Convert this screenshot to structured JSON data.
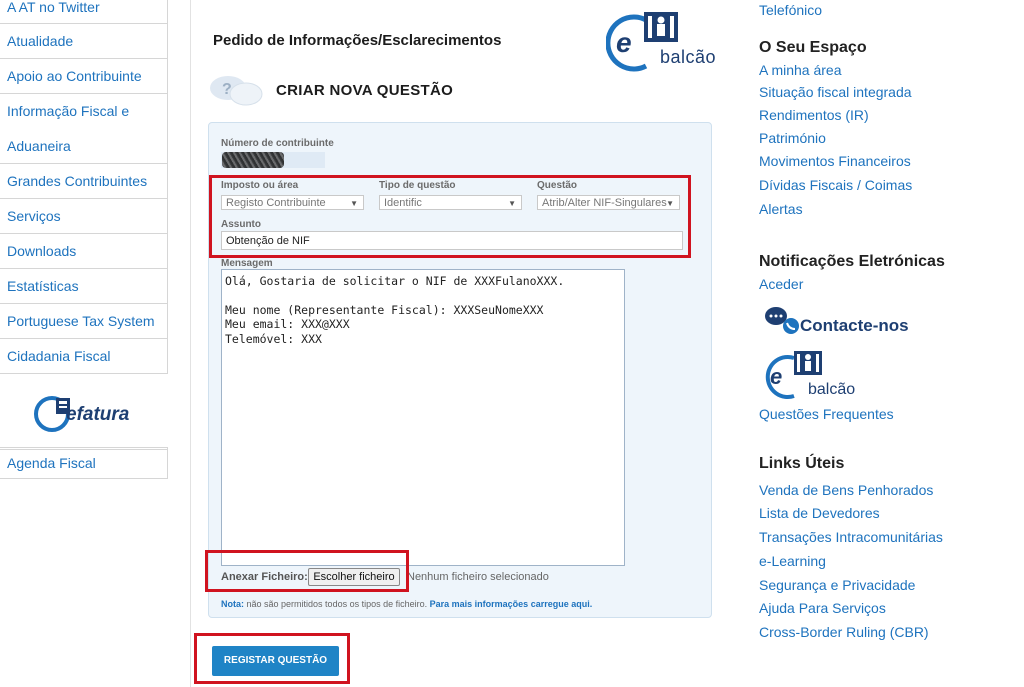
{
  "left_nav": {
    "items": [
      "A AT no Twitter",
      "Atualidade",
      "Apoio ao Contribuinte",
      "Informação Fiscal e",
      "Aduaneira",
      "Grandes Contribuintes",
      "Serviços",
      "Downloads",
      "Estatísticas",
      "Portuguese Tax System",
      "Cidadania Fiscal"
    ],
    "efatura_label": "efatura",
    "agenda": "Agenda Fiscal"
  },
  "main": {
    "page_title": "Pedido de Informações/Esclarecimentos",
    "balcao_label": "balcão",
    "new_question_title": "CRIAR NOVA QUESTÃO",
    "form": {
      "nif_label": "Número de contribuinte",
      "tax_area_label": "Imposto ou área",
      "tax_area_value": "Registo Contribuinte",
      "question_type_label": "Tipo de questão",
      "question_type_value": "Identific",
      "question_label": "Questão",
      "question_value": "Atrib/Alter NIF-Singulares",
      "subject_label": "Assunto",
      "subject_value": "Obtenção de NIF",
      "message_label": "Mensagem",
      "message_value": "Olá, Gostaria de solicitar o NIF de XXXFulanoXXX.\n\nMeu nome (Representante Fiscal): XXXSeuNomeXXX\nMeu email: XXX@XXX\nTelemóvel: XXX",
      "attach_label": "Anexar Ficheiro:",
      "choose_file_label": "Escolher ficheiro",
      "file_status": "Nenhum ficheiro selecionado",
      "note_prefix": "Nota:",
      "note_text": "não são permitidos todos os tipos de ficheiro.",
      "note_more": "Para mais informações carregue aqui."
    },
    "register_button": "REGISTAR QUESTÃO"
  },
  "right": {
    "top_link": "Telefónico",
    "espaco_heading": "O Seu Espaço",
    "espaco_links": [
      "A minha área",
      "Situação fiscal integrada",
      "Rendimentos (IR)",
      "Património",
      "Movimentos Financeiros",
      "Dívidas Fiscais / Coimas",
      "Alertas"
    ],
    "notif_heading": "Notificações Eletrónicas",
    "notif_link": "Aceder",
    "contact_label": "Contacte-nos",
    "balcao_label": "balcão",
    "faq_link": "Questões Frequentes",
    "links_heading": "Links Úteis",
    "useful_links": [
      "Venda de Bens Penhorados",
      "Lista de Devedores",
      "Transações Intracomunitárias",
      "e-Learning",
      "Segurança e Privacidade",
      "Ajuda Para Serviços",
      "Cross-Border Ruling (CBR)"
    ]
  },
  "colors": {
    "link": "#1e73be",
    "accent_button": "#1f84c6",
    "highlight_red": "#d0131f",
    "form_bg": "#eef5fb"
  }
}
